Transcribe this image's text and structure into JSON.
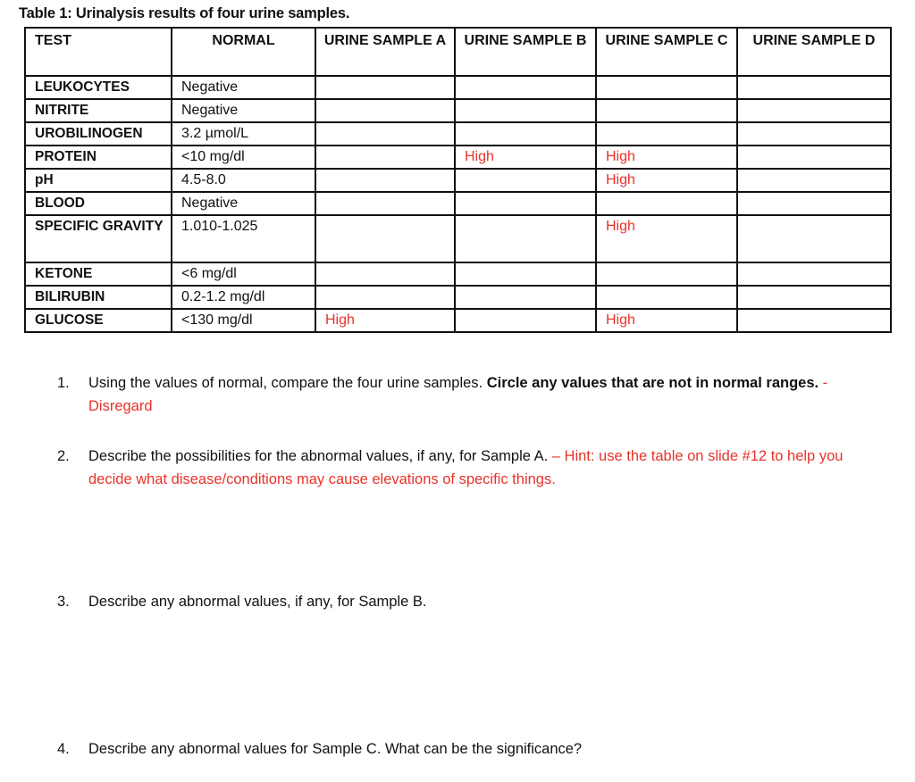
{
  "document": {
    "title": "Table 1: Urinalysis results of four urine samples.",
    "accent_color": "#e8322a"
  },
  "table": {
    "headers": [
      "TEST",
      "NORMAL",
      "URINE SAMPLE A",
      "URINE SAMPLE B",
      "URINE SAMPLE C",
      "URINE SAMPLE D"
    ],
    "rows": [
      {
        "test": "LEUKOCYTES",
        "normal": "Negative",
        "a": "",
        "b": "",
        "c": "",
        "d": ""
      },
      {
        "test": "NITRITE",
        "normal": "Negative",
        "a": "",
        "b": "",
        "c": "",
        "d": ""
      },
      {
        "test": "UROBILINOGEN",
        "normal": "3.2 µmol/L",
        "a": "",
        "b": "",
        "c": "",
        "d": ""
      },
      {
        "test": "PROTEIN",
        "normal": "<10 mg/dl",
        "a": "",
        "b": "High",
        "c": "High",
        "d": ""
      },
      {
        "test": "pH",
        "normal": "4.5-8.0",
        "a": "",
        "b": "",
        "c": "High",
        "d": ""
      },
      {
        "test": "BLOOD",
        "normal": "Negative",
        "a": "",
        "b": "",
        "c": "",
        "d": ""
      },
      {
        "test": "SPECIFIC GRAVITY",
        "normal": "1.010-1.025",
        "a": "",
        "b": "",
        "c": "High",
        "d": ""
      },
      {
        "test": "KETONE",
        "normal": "<6 mg/dl",
        "a": "",
        "b": "",
        "c": "",
        "d": ""
      },
      {
        "test": "BILIRUBIN",
        "normal": "0.2-1.2 mg/dl",
        "a": "",
        "b": "",
        "c": "",
        "d": ""
      },
      {
        "test": "GLUCOSE",
        "normal": "<130 mg/dl",
        "a": "High",
        "b": "",
        "c": "High",
        "d": ""
      }
    ]
  },
  "questions": [
    {
      "number": "1.",
      "text": "Using the values of normal, compare the four urine samples. ",
      "bold": "Circle any values that are not in normal ranges.",
      "note": " - Disregard"
    },
    {
      "number": "2.",
      "text": "Describe the possibilities for the abnormal values, if any, for Sample A. ",
      "bold": "",
      "note": " – Hint: use the table on slide #12 to help you decide what disease/conditions may cause elevations of specific things."
    },
    {
      "number": "3.",
      "text": "Describe any abnormal values, if any, for Sample B.",
      "bold": "",
      "note": ""
    },
    {
      "number": "4.",
      "text": "Describe any abnormal values for Sample C. What can be the significance?",
      "bold": "",
      "note": ""
    }
  ]
}
